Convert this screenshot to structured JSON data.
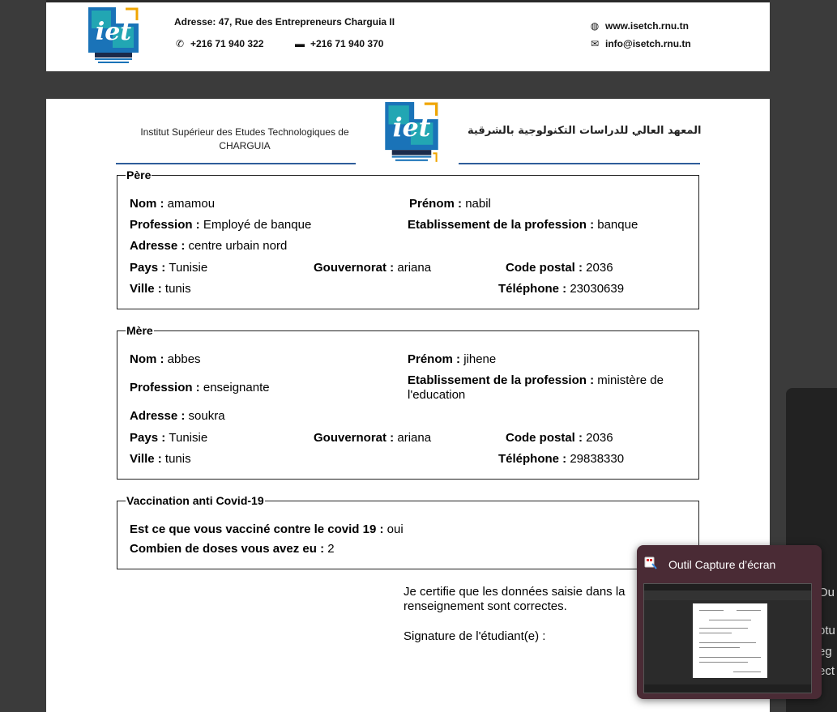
{
  "header": {
    "address": "Adresse:  47, Rue des Entrepreneurs Charguia II",
    "phone": "+216 71 940 322",
    "fax": "+216 71 940 370",
    "website": "www.isetch.rnu.tn",
    "email": "info@isetch.rnu.tn"
  },
  "institution": {
    "name_fr_line1": "Institut Supérieur des Etudes Technologiques de",
    "name_fr_line2": "CHARGUIA",
    "name_ar": "المعهد العالي للدراسات التكنولوجية بالشرقية"
  },
  "father": {
    "legend": "Père",
    "nom_label": "Nom : ",
    "nom": "amamou",
    "prenom_label": "Prénom : ",
    "prenom": "nabil",
    "profession_label": "Profession : ",
    "profession": "Employé de banque",
    "etab_label": "Etablissement de la profession : ",
    "etab": "banque",
    "adresse_label": "Adresse : ",
    "adresse": "centre urbain nord",
    "pays_label": "Pays : ",
    "pays": "Tunisie",
    "gouv_label": "Gouvernorat : ",
    "gouv": "ariana",
    "cp_label": "Code postal : ",
    "cp": "2036",
    "ville_label": "Ville : ",
    "ville": "tunis",
    "tel_label": "Téléphone : ",
    "tel": "23030639"
  },
  "mother": {
    "legend": "Mère",
    "nom_label": "Nom : ",
    "nom": "abbes",
    "prenom_label": "Prénom : ",
    "prenom": "jihene",
    "profession_label": "Profession : ",
    "profession": "enseignante",
    "etab_label": "Etablissement de la profession : ",
    "etab": "ministère de l'education",
    "adresse_label": "Adresse : ",
    "adresse": "soukra",
    "pays_label": "Pays : ",
    "pays": "Tunisie",
    "gouv_label": "Gouvernorat : ",
    "gouv": "ariana",
    "cp_label": "Code postal : ",
    "cp": "2036",
    "ville_label": "Ville : ",
    "ville": "tunis",
    "tel_label": "Téléphone : ",
    "tel": "29838330"
  },
  "covid": {
    "legend": "Vaccination anti Covid-19",
    "q1_label": "Est ce que vous vacciné contre le covid 19 : ",
    "q1": "oui",
    "q2_label": "Combien de doses vous avez eu : ",
    "q2": "2"
  },
  "certification": "Je certifie que les données saisie dans la renseignement sont correctes.",
  "signature_label": "Signature de l'étudiant(e) :",
  "snip_flyout": {
    "title": "Outil Capture d’écran"
  },
  "background_fragments": [
    "Ou",
    "otu",
    "eg",
    "ect"
  ],
  "colors": {
    "rule": "#2f5d9a",
    "logo_blue": "#1a73b8",
    "logo_teal": "#22a6b3",
    "logo_orange": "#f0a500"
  }
}
